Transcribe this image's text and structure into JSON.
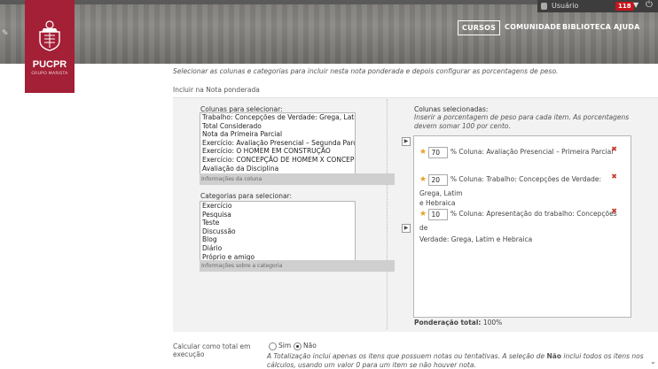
{
  "header": {
    "user_name": "Usuário",
    "notification_count": "118",
    "nav": [
      "CURSOS",
      "COMUNIDADE",
      "BIBLIOTECA",
      "AJUDA"
    ],
    "logo_text": "PUCPR",
    "logo_subtext": "GRUPO MARISTA"
  },
  "content": {
    "intro": "Selecionar as colunas e categorias para incluir nesta nota ponderada e depois configurar as porcentagens de peso.",
    "section_label": "Incluir na Nota ponderada",
    "columns_label": "Colunas para selecionar:",
    "columns": [
      "Trabalho: Concepções de Verdade: Grega, Latim e Hebraica",
      "Total Considerado",
      "Nota da Primeira Parcial",
      "Exercício: Avaliação Presencial – Segunda Parcial",
      "Exercício: O HOMEM EM CONSTRUÇÃO",
      "Exercício: CONCEPÇÃO DE HOMEM X CONCEPÇÃO",
      "Avaliação da Disciplina"
    ],
    "columns_info": "Informações da coluna",
    "categories_label": "Categorias para selecionar:",
    "categories": [
      "Exercício",
      "Pesquisa",
      "Teste",
      "Discussão",
      "Blog",
      "Diário",
      "Próprio e amigo"
    ],
    "categories_info": "Informações sobre a categoria",
    "selected_title": "Colunas selecionadas:",
    "selected_hint": "Inserir a porcentagem de peso para cada item. As porcentagens devem somar 100 por cento.",
    "selected": [
      {
        "percent": "70",
        "label": "% Coluna:",
        "name_line1": "Avaliação Presencial – Primeira Parcial",
        "name_line2": ""
      },
      {
        "percent": "20",
        "label": "% Coluna:",
        "name_line1": "Trabalho: Concepções de Verdade: Grega, Latim",
        "name_line2": "e Hebraica"
      },
      {
        "percent": "10",
        "label": "% Coluna:",
        "name_line1": "Apresentação do trabalho: Concepções de",
        "name_line2": "Verdade: Grega, Latim e Hebraica"
      }
    ],
    "total_label": "Ponderação total:",
    "total_value": "100%",
    "calc_label": "Calcular como total em execução",
    "calc_yes": "Sim",
    "calc_no": "Não",
    "calc_selected": "Não",
    "calc_help_1": "A Totalização inclui apenas os itens que possuem notas ou tentativas. A seleção de",
    "calc_help_bold": "Não",
    "calc_help_2": "inclui todos os itens nos cálculos, usando um valor 0 para um item se não houver nota."
  },
  "colors": {
    "brand": "#a32036",
    "badge": "#c4161c",
    "star": "#e8a020",
    "remove": "#c23b2c"
  }
}
